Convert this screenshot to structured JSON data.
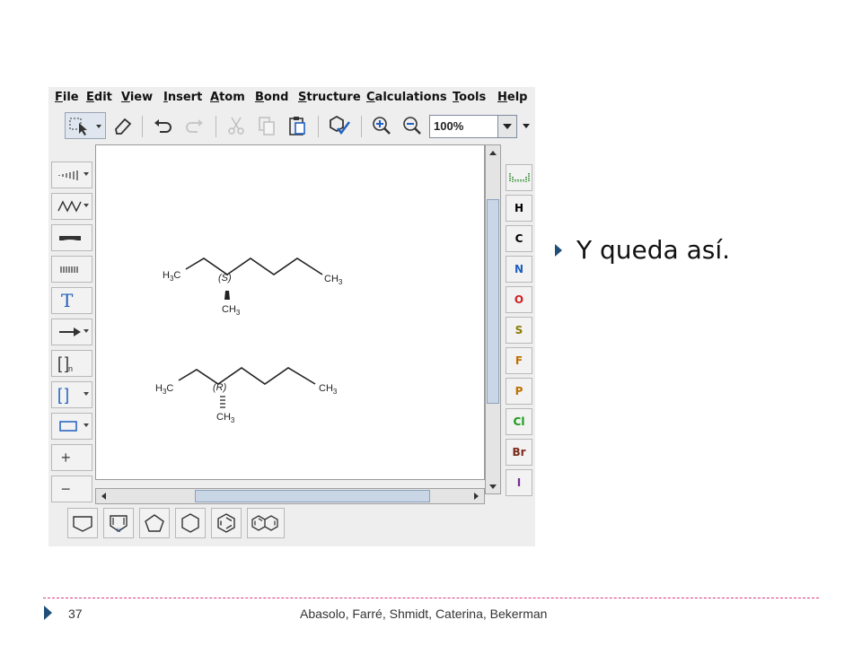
{
  "menu": [
    "File",
    "Edit",
    "View",
    "Insert",
    "Atom",
    "Bond",
    "Structure",
    "Calculations",
    "Tools",
    "Help"
  ],
  "toolbar": {
    "zoom_value": "100%",
    "icons": [
      "select-icon",
      "eraser-icon",
      "undo-icon",
      "redo-icon",
      "cut-icon",
      "copy-icon",
      "paste-icon",
      "check-structure-icon",
      "zoom-in-icon",
      "zoom-out-icon"
    ]
  },
  "left_tools": {
    "text_tool_label": "T",
    "sgroup_label": "[ ]",
    "sgroup_subscript": "n",
    "brackets_label": "[ ]",
    "charge_plus": "+",
    "charge_minus": "−"
  },
  "elements": [
    "H",
    "C",
    "N",
    "O",
    "S",
    "F",
    "P",
    "Cl",
    "Br",
    "I"
  ],
  "element_colors": {
    "H": "#222222",
    "C": "#222222",
    "N": "#1f5fbf",
    "O": "#d02020",
    "S": "#8a7a00",
    "F": "#c07000",
    "P": "#c07000",
    "Cl": "#1a9a1a",
    "Br": "#7a2a1a",
    "I": "#7a2a9a"
  },
  "molecules": [
    {
      "label_left_main": "H",
      "label_left_sub": "3",
      "label_left_end": "C",
      "stereo": "(S)",
      "label_right_main": "CH",
      "label_right_sub": "3",
      "label_methyl_main": "CH",
      "label_methyl_sub": "3"
    },
    {
      "label_left_main": "H",
      "label_left_sub": "3",
      "label_left_end": "C",
      "stereo": "(R)",
      "label_right_main": "CH",
      "label_right_sub": "3",
      "label_methyl_main": "CH",
      "label_methyl_sub": "3"
    }
  ],
  "templates": [
    "cyclohexane-boat-template",
    "pyrrole-template",
    "cyclopentane-template",
    "cyclohexane-template",
    "benzene-template",
    "naphthalene-template"
  ],
  "slide": {
    "bullet_text": "Y queda así.",
    "page_number": "37",
    "authors": "Abasolo, Farré, Shmidt, Caterina, Bekerman"
  }
}
